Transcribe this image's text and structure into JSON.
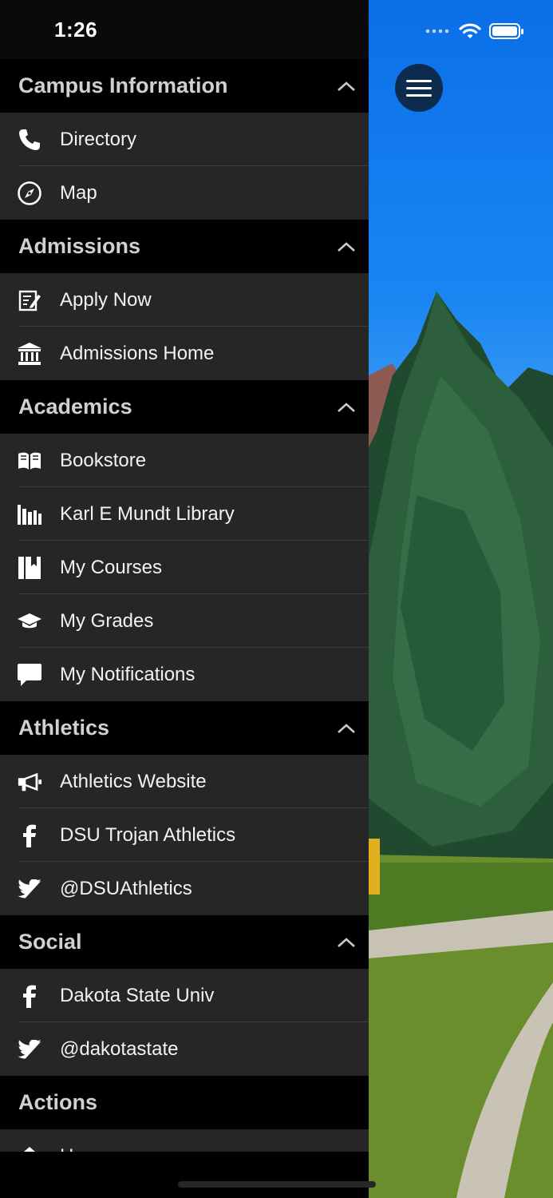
{
  "status_bar": {
    "time": "1:26"
  },
  "sections": [
    {
      "title": "Campus Information",
      "collapsible": true,
      "items": [
        {
          "label": "Directory",
          "icon": "phone-icon"
        },
        {
          "label": "Map",
          "icon": "compass-icon"
        }
      ]
    },
    {
      "title": "Admissions",
      "collapsible": true,
      "items": [
        {
          "label": "Apply Now",
          "icon": "edit-form-icon"
        },
        {
          "label": "Admissions Home",
          "icon": "institution-icon"
        }
      ]
    },
    {
      "title": "Academics",
      "collapsible": true,
      "items": [
        {
          "label": "Bookstore",
          "icon": "open-book-icon"
        },
        {
          "label": "Karl E Mundt Library",
          "icon": "library-books-icon"
        },
        {
          "label": "My Courses",
          "icon": "courses-book-icon"
        },
        {
          "label": "My Grades",
          "icon": "graduation-cap-icon"
        },
        {
          "label": "My Notifications",
          "icon": "chat-bubble-icon"
        }
      ]
    },
    {
      "title": "Athletics",
      "collapsible": true,
      "items": [
        {
          "label": "Athletics Website",
          "icon": "megaphone-icon"
        },
        {
          "label": "DSU Trojan Athletics",
          "icon": "facebook-icon"
        },
        {
          "label": "@DSUAthletics",
          "icon": "twitter-icon"
        }
      ]
    },
    {
      "title": "Social",
      "collapsible": true,
      "items": [
        {
          "label": "Dakota State Univ",
          "icon": "facebook-icon"
        },
        {
          "label": "@dakotastate",
          "icon": "twitter-icon"
        }
      ]
    },
    {
      "title": "Actions",
      "collapsible": false,
      "items": [
        {
          "label": "Home",
          "icon": "home-icon"
        }
      ]
    }
  ],
  "colors": {
    "drawer_bg": "#000000",
    "item_bg": "#262626",
    "menu_button": "#0d2b4f"
  }
}
